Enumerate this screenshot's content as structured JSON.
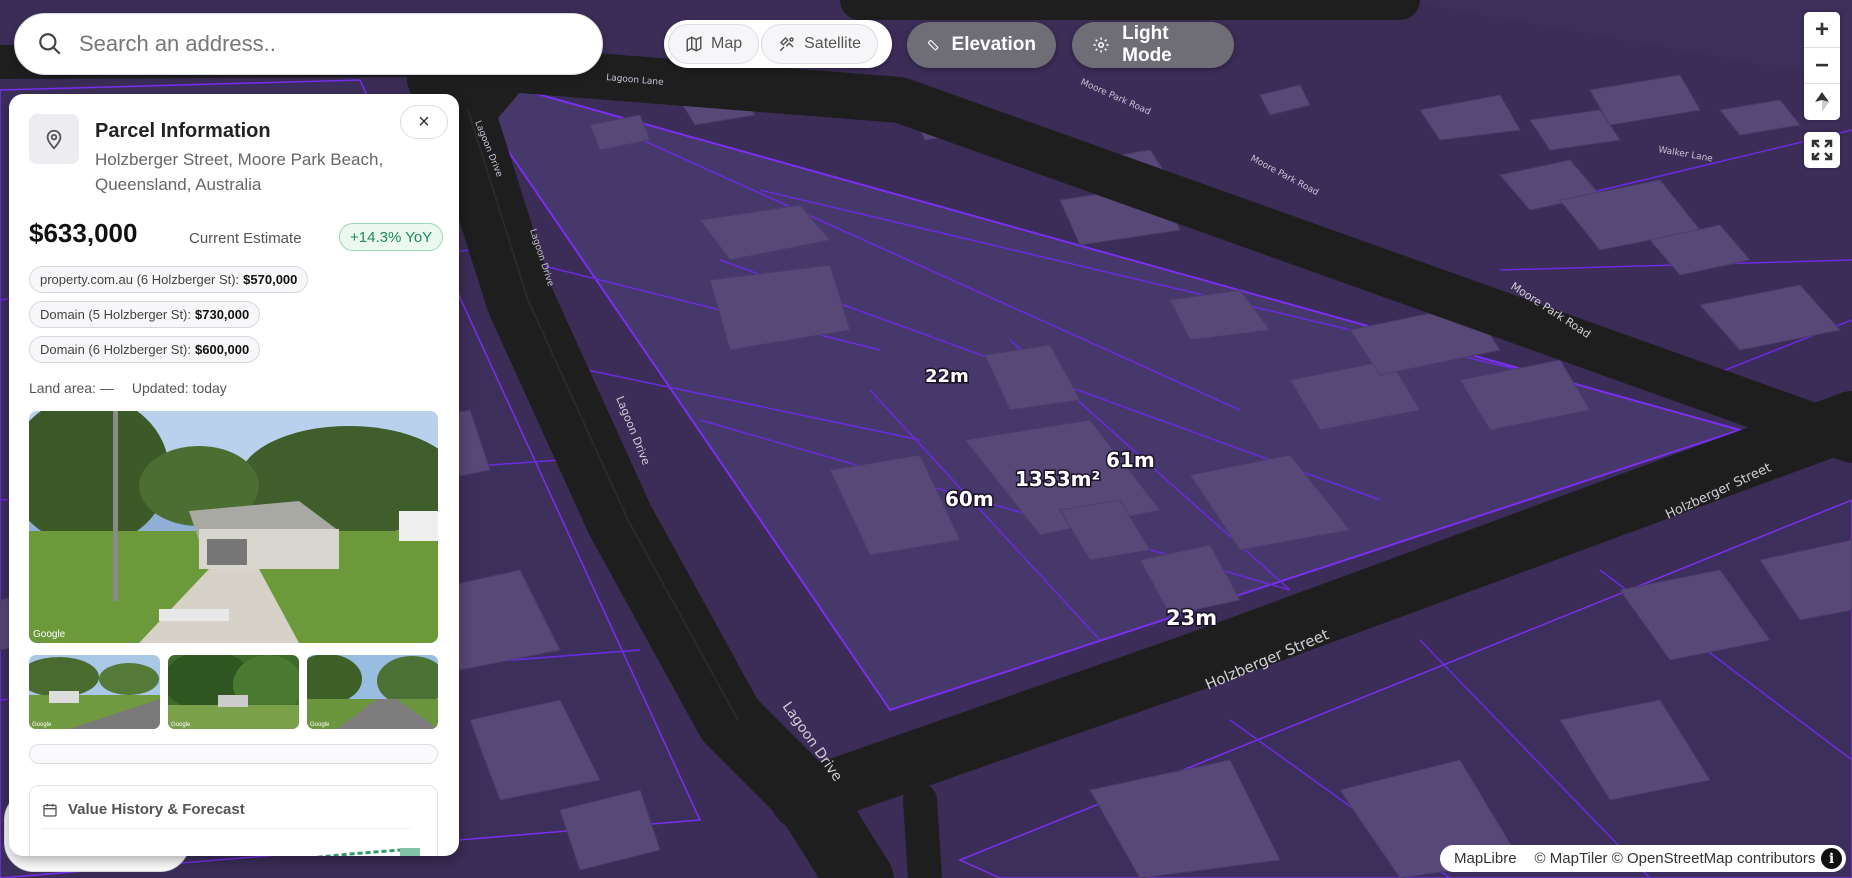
{
  "search": {
    "placeholder": "Search an address.."
  },
  "toggle": {
    "map_label": "Map",
    "satellite_label": "Satellite"
  },
  "buttons": {
    "elevation_label": "Elevation",
    "light_mode_label": "Light Mode"
  },
  "map": {
    "roads": {
      "lagoon_drive_lower": "Lagoon Drive",
      "lagoon_drive_mid": "Lagoon Drive",
      "lagoon_drive_upper": "Lagoon Drive",
      "lagoon_drive_top": "Lagoon Drive",
      "holzberger_street_lower": "Holzberger Street",
      "holzberger_street_right": "Holzberger Street",
      "moore_park_road": "Moore Park Road",
      "moore_park_road_upper": "Moore Park Road",
      "moore_park_road_top": "Moore Park Road",
      "lagoon_lane_top": "Lagoon Lane",
      "walker_lane": "Walker Lane"
    },
    "dimensions": {
      "top_edge": "22m",
      "left_edge": "60m",
      "right_edge": "61m",
      "bottom_edge": "23m",
      "area": "1353m²"
    }
  },
  "attribution": {
    "maplibre": "MapLibre",
    "maptiler": "© MapTiler © OpenStreetMap contributors",
    "info": "i"
  },
  "panel": {
    "title": "Parcel Information",
    "address": "Holzberger Street, Moore Park Beach, Queensland, Australia",
    "close": "×",
    "price": "$633,000",
    "price_label": "Current Estimate",
    "yoy": "+14.3% YoY",
    "sources": [
      {
        "label": "property.com.au (6 Holzberger St):",
        "value": "$570,000"
      },
      {
        "label": "Domain (5 Holzberger St):",
        "value": "$730,000"
      },
      {
        "label": "Domain (6 Holzberger St):",
        "value": "$600,000"
      }
    ],
    "land_area": "Land area: —",
    "updated": "Updated: today",
    "photo_credit": "Google",
    "history_title": "Value History & Forecast"
  },
  "colors": {
    "parcel_fill": "#4b3a6e",
    "parcel_outline": "#7a2ff0",
    "road": "#222222",
    "building": "#5a4a7c",
    "yoy_green": "#1f8a56"
  }
}
